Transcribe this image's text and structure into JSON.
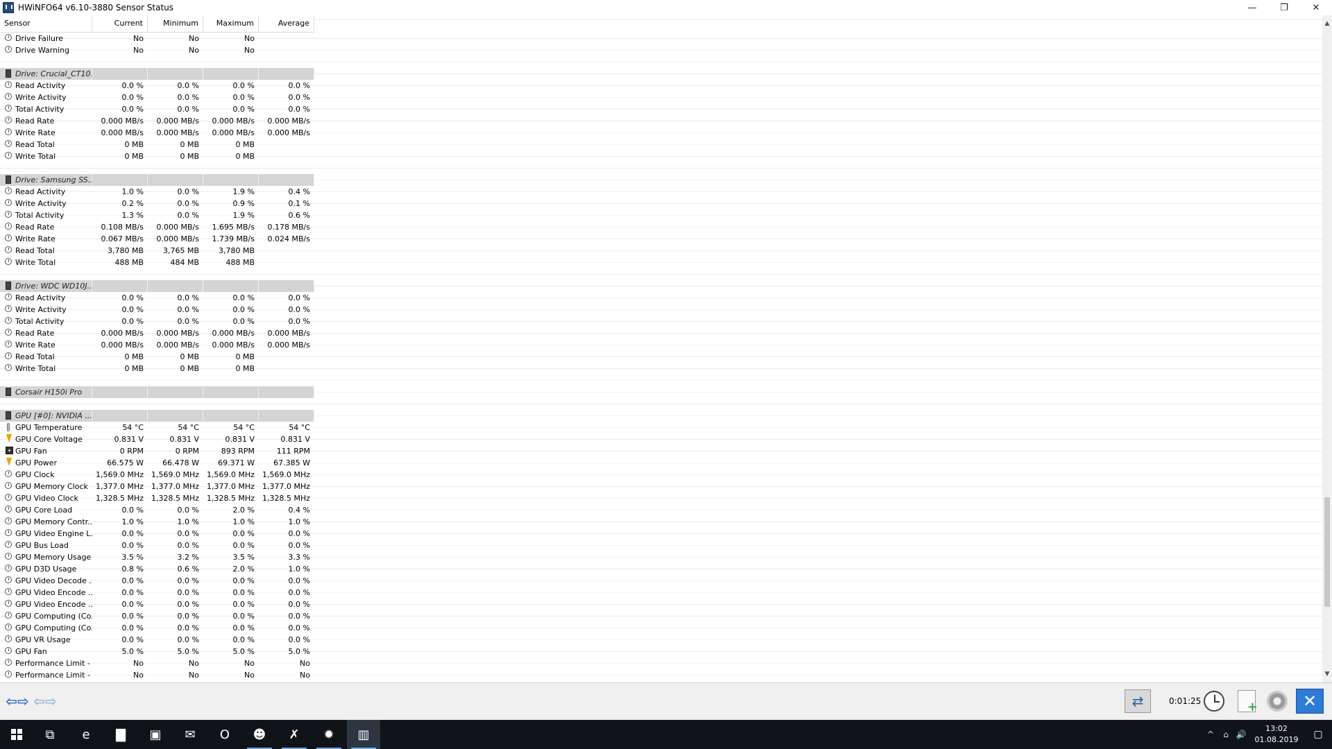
{
  "window": {
    "title": "HWiNFO64 v6.10-3880 Sensor Status",
    "minimize": "—",
    "restore": "❐",
    "close": "✕"
  },
  "columns": [
    "Sensor",
    "Current",
    "Minimum",
    "Maximum",
    "Average"
  ],
  "rows": [
    {
      "type": "item",
      "icon": "clock",
      "name": "Drive Failure",
      "cur": "No",
      "min": "No",
      "max": "No",
      "avg": ""
    },
    {
      "type": "item",
      "icon": "clock",
      "name": "Drive Warning",
      "cur": "No",
      "min": "No",
      "max": "No",
      "avg": ""
    },
    {
      "type": "blank"
    },
    {
      "type": "group",
      "name": "Drive: Crucial_CT10..."
    },
    {
      "type": "item",
      "icon": "clock",
      "name": "Read Activity",
      "cur": "0.0 %",
      "min": "0.0 %",
      "max": "0.0 %",
      "avg": "0.0 %"
    },
    {
      "type": "item",
      "icon": "clock",
      "name": "Write Activity",
      "cur": "0.0 %",
      "min": "0.0 %",
      "max": "0.0 %",
      "avg": "0.0 %"
    },
    {
      "type": "item",
      "icon": "clock",
      "name": "Total Activity",
      "cur": "0.0 %",
      "min": "0.0 %",
      "max": "0.0 %",
      "avg": "0.0 %"
    },
    {
      "type": "item",
      "icon": "clock",
      "name": "Read Rate",
      "cur": "0.000 MB/s",
      "min": "0.000 MB/s",
      "max": "0.000 MB/s",
      "avg": "0.000 MB/s"
    },
    {
      "type": "item",
      "icon": "clock",
      "name": "Write Rate",
      "cur": "0.000 MB/s",
      "min": "0.000 MB/s",
      "max": "0.000 MB/s",
      "avg": "0.000 MB/s"
    },
    {
      "type": "item",
      "icon": "clock",
      "name": "Read Total",
      "cur": "0 MB",
      "min": "0 MB",
      "max": "0 MB",
      "avg": ""
    },
    {
      "type": "item",
      "icon": "clock",
      "name": "Write Total",
      "cur": "0 MB",
      "min": "0 MB",
      "max": "0 MB",
      "avg": ""
    },
    {
      "type": "blank"
    },
    {
      "type": "group",
      "name": "Drive: Samsung SS..."
    },
    {
      "type": "item",
      "icon": "clock",
      "name": "Read Activity",
      "cur": "1.0 %",
      "min": "0.0 %",
      "max": "1.9 %",
      "avg": "0.4 %"
    },
    {
      "type": "item",
      "icon": "clock",
      "name": "Write Activity",
      "cur": "0.2 %",
      "min": "0.0 %",
      "max": "0.9 %",
      "avg": "0.1 %"
    },
    {
      "type": "item",
      "icon": "clock",
      "name": "Total Activity",
      "cur": "1.3 %",
      "min": "0.0 %",
      "max": "1.9 %",
      "avg": "0.6 %"
    },
    {
      "type": "item",
      "icon": "clock",
      "name": "Read Rate",
      "cur": "0.108 MB/s",
      "min": "0.000 MB/s",
      "max": "1.695 MB/s",
      "avg": "0.178 MB/s"
    },
    {
      "type": "item",
      "icon": "clock",
      "name": "Write Rate",
      "cur": "0.067 MB/s",
      "min": "0.000 MB/s",
      "max": "1.739 MB/s",
      "avg": "0.024 MB/s"
    },
    {
      "type": "item",
      "icon": "clock",
      "name": "Read Total",
      "cur": "3,780 MB",
      "min": "3,765 MB",
      "max": "3,780 MB",
      "avg": ""
    },
    {
      "type": "item",
      "icon": "clock",
      "name": "Write Total",
      "cur": "488 MB",
      "min": "484 MB",
      "max": "488 MB",
      "avg": ""
    },
    {
      "type": "blank"
    },
    {
      "type": "group",
      "name": "Drive: WDC WD10J..."
    },
    {
      "type": "item",
      "icon": "clock",
      "name": "Read Activity",
      "cur": "0.0 %",
      "min": "0.0 %",
      "max": "0.0 %",
      "avg": "0.0 %"
    },
    {
      "type": "item",
      "icon": "clock",
      "name": "Write Activity",
      "cur": "0.0 %",
      "min": "0.0 %",
      "max": "0.0 %",
      "avg": "0.0 %"
    },
    {
      "type": "item",
      "icon": "clock",
      "name": "Total Activity",
      "cur": "0.0 %",
      "min": "0.0 %",
      "max": "0.0 %",
      "avg": "0.0 %"
    },
    {
      "type": "item",
      "icon": "clock",
      "name": "Read Rate",
      "cur": "0.000 MB/s",
      "min": "0.000 MB/s",
      "max": "0.000 MB/s",
      "avg": "0.000 MB/s"
    },
    {
      "type": "item",
      "icon": "clock",
      "name": "Write Rate",
      "cur": "0.000 MB/s",
      "min": "0.000 MB/s",
      "max": "0.000 MB/s",
      "avg": "0.000 MB/s"
    },
    {
      "type": "item",
      "icon": "clock",
      "name": "Read Total",
      "cur": "0 MB",
      "min": "0 MB",
      "max": "0 MB",
      "avg": ""
    },
    {
      "type": "item",
      "icon": "clock",
      "name": "Write Total",
      "cur": "0 MB",
      "min": "0 MB",
      "max": "0 MB",
      "avg": ""
    },
    {
      "type": "blank"
    },
    {
      "type": "group",
      "name": "Corsair H150i Pro"
    },
    {
      "type": "blank"
    },
    {
      "type": "group",
      "name": "GPU [#0]: NVIDIA ..."
    },
    {
      "type": "item",
      "icon": "therm",
      "name": "GPU Temperature",
      "cur": "54 °C",
      "min": "54 °C",
      "max": "54 °C",
      "avg": "54 °C"
    },
    {
      "type": "item",
      "icon": "bolt",
      "name": "GPU Core Voltage",
      "cur": "0.831 V",
      "min": "0.831 V",
      "max": "0.831 V",
      "avg": "0.831 V"
    },
    {
      "type": "item",
      "icon": "fan",
      "name": "GPU Fan",
      "cur": "0 RPM",
      "min": "0 RPM",
      "max": "893 RPM",
      "avg": "111 RPM"
    },
    {
      "type": "item",
      "icon": "bolt",
      "name": "GPU Power",
      "cur": "66.575 W",
      "min": "66.478 W",
      "max": "69.371 W",
      "avg": "67.385 W"
    },
    {
      "type": "item",
      "icon": "clock",
      "name": "GPU Clock",
      "cur": "1,569.0 MHz",
      "min": "1,569.0 MHz",
      "max": "1,569.0 MHz",
      "avg": "1,569.0 MHz"
    },
    {
      "type": "item",
      "icon": "clock",
      "name": "GPU Memory Clock",
      "cur": "1,377.0 MHz",
      "min": "1,377.0 MHz",
      "max": "1,377.0 MHz",
      "avg": "1,377.0 MHz"
    },
    {
      "type": "item",
      "icon": "clock",
      "name": "GPU Video Clock",
      "cur": "1,328.5 MHz",
      "min": "1,328.5 MHz",
      "max": "1,328.5 MHz",
      "avg": "1,328.5 MHz"
    },
    {
      "type": "item",
      "icon": "clock",
      "name": "GPU Core Load",
      "cur": "0.0 %",
      "min": "0.0 %",
      "max": "2.0 %",
      "avg": "0.4 %"
    },
    {
      "type": "item",
      "icon": "clock",
      "name": "GPU Memory Contr...",
      "cur": "1.0 %",
      "min": "1.0 %",
      "max": "1.0 %",
      "avg": "1.0 %"
    },
    {
      "type": "item",
      "icon": "clock",
      "name": "GPU Video Engine L...",
      "cur": "0.0 %",
      "min": "0.0 %",
      "max": "0.0 %",
      "avg": "0.0 %"
    },
    {
      "type": "item",
      "icon": "clock",
      "name": "GPU Bus Load",
      "cur": "0.0 %",
      "min": "0.0 %",
      "max": "0.0 %",
      "avg": "0.0 %"
    },
    {
      "type": "item",
      "icon": "clock",
      "name": "GPU Memory Usage",
      "cur": "3.5 %",
      "min": "3.2 %",
      "max": "3.5 %",
      "avg": "3.3 %"
    },
    {
      "type": "item",
      "icon": "clock",
      "name": "GPU D3D Usage",
      "cur": "0.8 %",
      "min": "0.6 %",
      "max": "2.0 %",
      "avg": "1.0 %"
    },
    {
      "type": "item",
      "icon": "clock",
      "name": "GPU Video Decode ...",
      "cur": "0.0 %",
      "min": "0.0 %",
      "max": "0.0 %",
      "avg": "0.0 %"
    },
    {
      "type": "item",
      "icon": "clock",
      "name": "GPU Video Encode ...",
      "cur": "0.0 %",
      "min": "0.0 %",
      "max": "0.0 %",
      "avg": "0.0 %"
    },
    {
      "type": "item",
      "icon": "clock",
      "name": "GPU Video Encode ...",
      "cur": "0.0 %",
      "min": "0.0 %",
      "max": "0.0 %",
      "avg": "0.0 %"
    },
    {
      "type": "item",
      "icon": "clock",
      "name": "GPU Computing (Co...",
      "cur": "0.0 %",
      "min": "0.0 %",
      "max": "0.0 %",
      "avg": "0.0 %"
    },
    {
      "type": "item",
      "icon": "clock",
      "name": "GPU Computing (Co...",
      "cur": "0.0 %",
      "min": "0.0 %",
      "max": "0.0 %",
      "avg": "0.0 %"
    },
    {
      "type": "item",
      "icon": "clock",
      "name": "GPU VR Usage",
      "cur": "0.0 %",
      "min": "0.0 %",
      "max": "0.0 %",
      "avg": "0.0 %"
    },
    {
      "type": "item",
      "icon": "clock",
      "name": "GPU Fan",
      "cur": "5.0 %",
      "min": "5.0 %",
      "max": "5.0 %",
      "avg": "5.0 %"
    },
    {
      "type": "item",
      "icon": "clock",
      "name": "Performance Limit - ...",
      "cur": "No",
      "min": "No",
      "max": "No",
      "avg": "No"
    },
    {
      "type": "item",
      "icon": "clock",
      "name": "Performance Limit - ...",
      "cur": "No",
      "min": "No",
      "max": "No",
      "avg": "No"
    }
  ],
  "toolbar": {
    "timer": "0:01:25",
    "nav_back": "⇦⇨",
    "nav_forward": "⇦⇨",
    "sync_glyph": "⇄",
    "close_glyph": "✕"
  },
  "taskbar": {
    "clock_time": "13:02",
    "clock_date": "01.08.2019",
    "items": [
      {
        "name": "windows-start-icon",
        "glyph": ""
      },
      {
        "name": "task-view-icon",
        "glyph": "⧉"
      },
      {
        "name": "edge-icon",
        "glyph": "e"
      },
      {
        "name": "file-explorer-icon",
        "glyph": "▇"
      },
      {
        "name": "store-icon",
        "glyph": "▣"
      },
      {
        "name": "mail-icon",
        "glyph": "✉"
      },
      {
        "name": "opera-icon",
        "glyph": "O"
      },
      {
        "name": "app-face-icon",
        "glyph": "☻"
      },
      {
        "name": "app-green-icon",
        "glyph": "✗"
      },
      {
        "name": "app-red-icon",
        "glyph": "✹"
      },
      {
        "name": "hwinfo-taskbar-icon",
        "glyph": "▥"
      }
    ],
    "tray": [
      "^",
      "⌂",
      "🔊"
    ],
    "notification_glyph": "▢"
  },
  "colors": {
    "group_row_bg": "#d4d4d4",
    "accent_blue": "#2f7bd6",
    "taskbar_bg": "#101418"
  }
}
